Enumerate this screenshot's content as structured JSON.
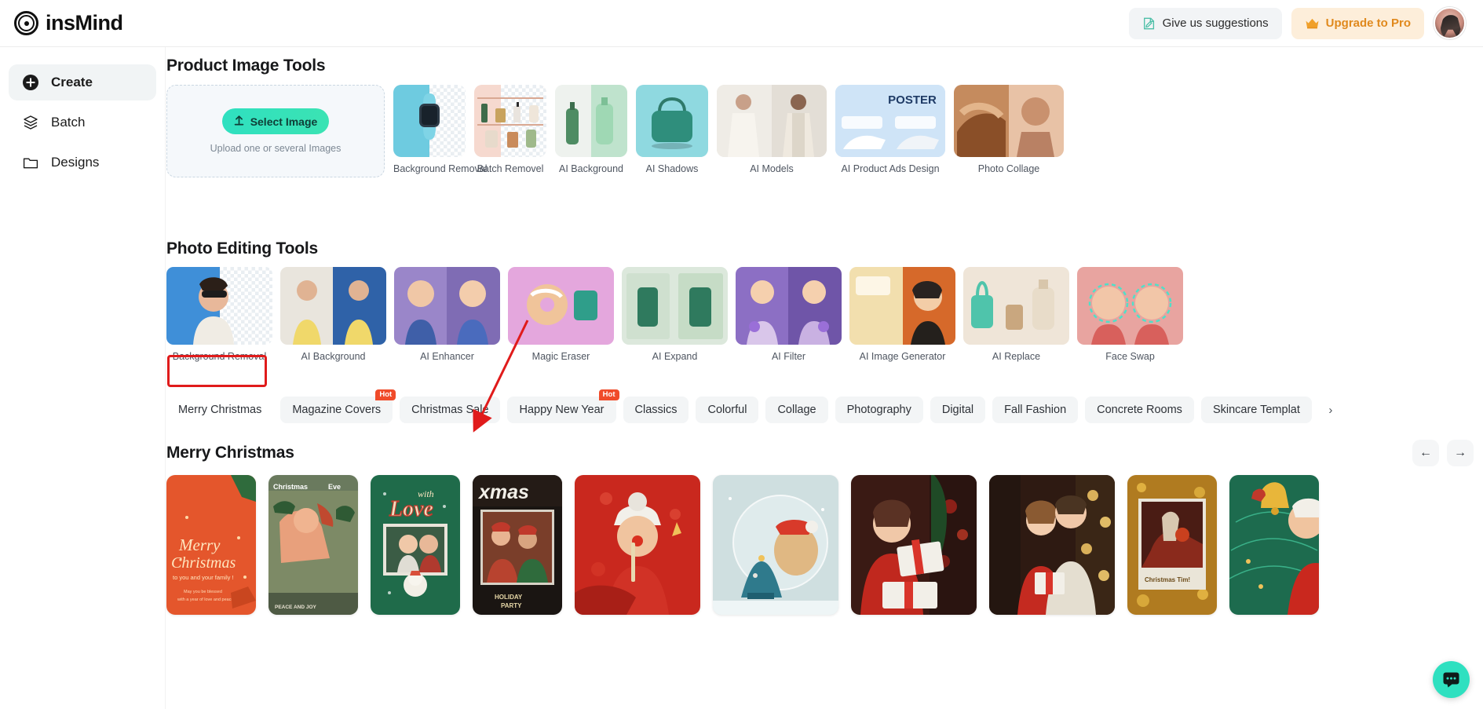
{
  "header": {
    "brand": "insMind",
    "brand_icon": "insmind-logo-icon",
    "suggestions_label": "Give us suggestions",
    "suggestions_icon": "feedback-document-icon",
    "upgrade_label": "Upgrade to Pro",
    "upgrade_icon": "crown-icon",
    "avatar_name": "user-avatar",
    "colors": {
      "upgrade_bg": "#fdeeda",
      "upgrade_text": "#e0891d",
      "accent": "#2fe0c0"
    }
  },
  "sidebar": {
    "items": [
      {
        "label": "Create",
        "icon": "plus-circle-icon",
        "active": true
      },
      {
        "label": "Batch",
        "icon": "layers-icon",
        "active": false
      },
      {
        "label": "Designs",
        "icon": "folder-icon",
        "active": false
      }
    ]
  },
  "product_section": {
    "title": "Product Image Tools",
    "upload": {
      "button_label": "Select Image",
      "button_icon": "upload-arrow-icon",
      "hint": "Upload one or several Images"
    },
    "tools": [
      {
        "label": "Background Removal",
        "art": "watch"
      },
      {
        "label": "Batch Removel",
        "art": "shelf"
      },
      {
        "label": "AI Background",
        "art": "bottles"
      },
      {
        "label": "AI Shadows",
        "art": "bag"
      },
      {
        "label": "AI Models",
        "art": "models"
      },
      {
        "label": "AI Product Ads Design",
        "art": "poster",
        "wide": true
      },
      {
        "label": "Photo Collage",
        "art": "collage",
        "wide": true
      }
    ]
  },
  "photo_section": {
    "title": "Photo Editing Tools",
    "tools": [
      {
        "label": "Background Removal",
        "art": "pe-bgremoval"
      },
      {
        "label": "AI Background",
        "art": "pe-aibg"
      },
      {
        "label": "AI Enhancer",
        "art": "pe-enhancer"
      },
      {
        "label": "Magic Eraser",
        "art": "pe-eraser"
      },
      {
        "label": "AI Expand",
        "art": "pe-expand"
      },
      {
        "label": "AI Filter",
        "art": "pe-filter"
      },
      {
        "label": "AI Image Generator",
        "art": "pe-generator"
      },
      {
        "label": "AI Replace",
        "art": "pe-replace"
      },
      {
        "label": "Face Swap",
        "art": "pe-faceswap"
      }
    ]
  },
  "tabs": {
    "items": [
      {
        "label": "Merry Christmas",
        "badge": "",
        "selected": true
      },
      {
        "label": "Magazine Covers",
        "badge": "Hot",
        "selected": false
      },
      {
        "label": "Christmas Sale",
        "badge": "",
        "selected": false
      },
      {
        "label": "Happy New Year",
        "badge": "Hot",
        "selected": false
      },
      {
        "label": "Classics",
        "badge": "",
        "selected": false
      },
      {
        "label": "Colorful",
        "badge": "",
        "selected": false
      },
      {
        "label": "Collage",
        "badge": "",
        "selected": false
      },
      {
        "label": "Photography",
        "badge": "",
        "selected": false
      },
      {
        "label": "Digital",
        "badge": "",
        "selected": false
      },
      {
        "label": "Fall Fashion",
        "badge": "",
        "selected": false
      },
      {
        "label": "Concrete Rooms",
        "badge": "",
        "selected": false
      },
      {
        "label": "Skincare Templat",
        "badge": "",
        "selected": false
      }
    ],
    "next_icon": "chevron-right-icon"
  },
  "gallery": {
    "title": "Merry Christmas",
    "prev_icon": "arrow-left-icon",
    "next_icon": "arrow-right-icon",
    "templates": [
      {
        "art": "t-merry",
        "text_lines": [
          "Merry",
          "Christmas",
          "to you and your family !",
          "May you be blessed",
          "with a year of love and peace"
        ]
      },
      {
        "art": "t-eve",
        "text_lines": [
          "Christmas",
          "Eve",
          "PEACE AND JOY"
        ]
      },
      {
        "art": "t-withlove",
        "text_lines": [
          "with",
          "Love"
        ]
      },
      {
        "art": "t-xmas",
        "text_lines": [
          "xmas",
          "HOLIDAY PARTY"
        ]
      },
      {
        "art": "t-redboy",
        "text_lines": [],
        "wide": true
      },
      {
        "art": "t-dog",
        "text_lines": [],
        "wide": true
      },
      {
        "art": "t-woman",
        "text_lines": [],
        "wide": true
      },
      {
        "art": "t-family",
        "text_lines": [],
        "wide": true
      },
      {
        "art": "t-gold",
        "text_lines": [
          "Christmas Tim!"
        ]
      },
      {
        "art": "t-greenbell",
        "text_lines": []
      }
    ]
  },
  "chat": {
    "icon": "chat-bubble-icon",
    "color": "#2fe0c0"
  },
  "annotations": {
    "highlight_target": "Merry Christmas",
    "arrow_target": "xmas-template-card",
    "color": "#e01b1b"
  }
}
